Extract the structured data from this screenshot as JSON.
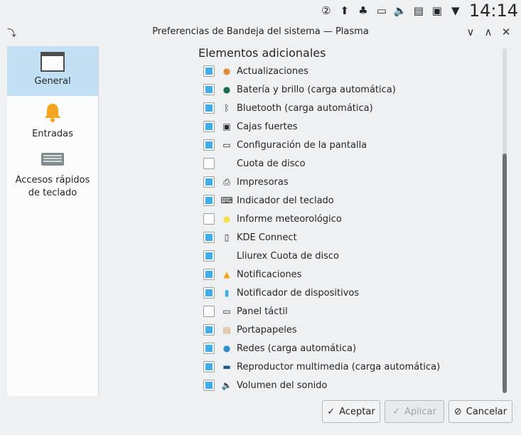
{
  "tray": {
    "icons": [
      "updates-badge-icon",
      "upload-icon",
      "kde-connect-icon",
      "display-icon",
      "volume-icon",
      "clipboard-icon",
      "vault-icon",
      "arrow-icon"
    ],
    "updates_badge": "②",
    "clock": "14:14"
  },
  "window": {
    "title": "Preferencias de Bandeja del sistema — Plasma",
    "minimize": "∨",
    "maximize": "∧",
    "close": "✕"
  },
  "sidebar": {
    "items": [
      {
        "label": "General",
        "icon": "window-icon",
        "active": true
      },
      {
        "label": "Entradas",
        "icon": "bell-icon",
        "active": false
      },
      {
        "label": "Accesos rápidos de teclado",
        "icon": "keyboard-icon",
        "active": false
      }
    ]
  },
  "content": {
    "heading": "Elementos adicionales",
    "items": [
      {
        "label": "Actualizaciones",
        "checked": true,
        "icon": "updates-icon"
      },
      {
        "label": "Batería y brillo (carga automática)",
        "checked": true,
        "icon": "battery-icon"
      },
      {
        "label": "Bluetooth (carga automática)",
        "checked": true,
        "icon": "bluetooth-icon"
      },
      {
        "label": "Cajas fuertes",
        "checked": true,
        "icon": "vault-icon"
      },
      {
        "label": "Configuración de la pantalla",
        "checked": true,
        "icon": "display-icon"
      },
      {
        "label": "Cuota de disco",
        "checked": false,
        "icon": ""
      },
      {
        "label": "Impresoras",
        "checked": true,
        "icon": "printer-icon"
      },
      {
        "label": "Indicador del teclado",
        "checked": true,
        "icon": "keyboard-icon"
      },
      {
        "label": "Informe meteorológico",
        "checked": false,
        "icon": "weather-icon"
      },
      {
        "label": "KDE Connect",
        "checked": true,
        "icon": "phone-icon"
      },
      {
        "label": "Lliurex Cuota de disco",
        "checked": true,
        "icon": ""
      },
      {
        "label": "Notificaciones",
        "checked": true,
        "icon": "bell-icon"
      },
      {
        "label": "Notificador de dispositivos",
        "checked": true,
        "icon": "usb-icon"
      },
      {
        "label": "Panel táctil",
        "checked": false,
        "icon": "touchpad-icon"
      },
      {
        "label": "Portapapeles",
        "checked": true,
        "icon": "clipboard-icon"
      },
      {
        "label": "Redes (carga automática)",
        "checked": true,
        "icon": "network-icon"
      },
      {
        "label": "Reproductor multimedia (carga automática)",
        "checked": true,
        "icon": "media-player-icon"
      },
      {
        "label": "Volumen del sonido",
        "checked": true,
        "icon": "volume-icon"
      }
    ]
  },
  "buttons": {
    "accept": "Aceptar",
    "apply": "Aplicar",
    "cancel": "Cancelar"
  },
  "colors": {
    "accent": "#3daee9",
    "selection": "#c2e0f4",
    "background": "#eff0f1"
  }
}
